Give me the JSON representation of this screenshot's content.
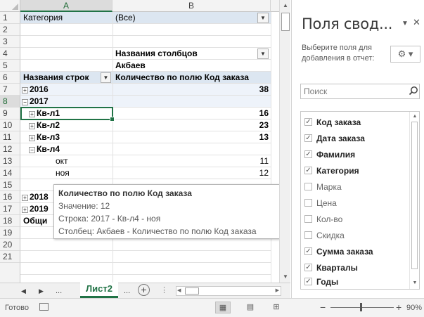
{
  "columns": [
    "A",
    "B"
  ],
  "rows": [
    "1",
    "2",
    "3",
    "4",
    "5",
    "6",
    "7",
    "8",
    "9",
    "10",
    "11",
    "12",
    "13",
    "14",
    "15",
    "16",
    "17",
    "18",
    "19",
    "20",
    "21"
  ],
  "cells": {
    "r1a": "Категория",
    "r1b": "(Все)",
    "r3b": "Названия столбцов",
    "r4b": "Акбаев",
    "r5a": "Названия строк",
    "r5b": "Количество по полю Код заказа",
    "r6a": "2016",
    "r6b": "38",
    "r7a": "2017",
    "r8a": "Кв-л1",
    "r8b": "16",
    "r9a": "Кв-л2",
    "r9b": "23",
    "r10a": "Кв-л3",
    "r10b": "13",
    "r11a": "Кв-л4",
    "r12a": "окт",
    "r12b": "11",
    "r13a": "ноя",
    "r13b": "12",
    "r15a": "2018",
    "r16a": "2019",
    "r17a": "Общи"
  },
  "tooltip": {
    "title": "Количество по полю Код заказа",
    "value": "Значение: 12",
    "row": "Строка: 2017 - Кв-л4 - ноя",
    "column": "Столбец: Акбаев - Количество по полю Код заказа"
  },
  "sheet_tabs": {
    "ellipsis_left": "...",
    "active": "Лист2",
    "ellipsis_right": "..."
  },
  "status": {
    "ready": "Готово",
    "zoom": "90%"
  },
  "pane": {
    "title": "Поля свод...",
    "description": "Выберите поля для добавления в отчет:",
    "search_placeholder": "Поиск",
    "fields": [
      {
        "label": "Код заказа",
        "checked": true
      },
      {
        "label": "Дата заказа",
        "checked": true
      },
      {
        "label": "Фамилия",
        "checked": true
      },
      {
        "label": "Категория",
        "checked": true
      },
      {
        "label": "Марка",
        "checked": false
      },
      {
        "label": "Цена",
        "checked": false
      },
      {
        "label": "Кол-во",
        "checked": false
      },
      {
        "label": "Скидка",
        "checked": false
      },
      {
        "label": "Сумма заказа",
        "checked": true
      },
      {
        "label": "Кварталы",
        "checked": true
      },
      {
        "label": "Годы",
        "checked": true
      }
    ]
  },
  "colors": {
    "accent": "#217346",
    "pivot_band": "#dce6f1"
  }
}
